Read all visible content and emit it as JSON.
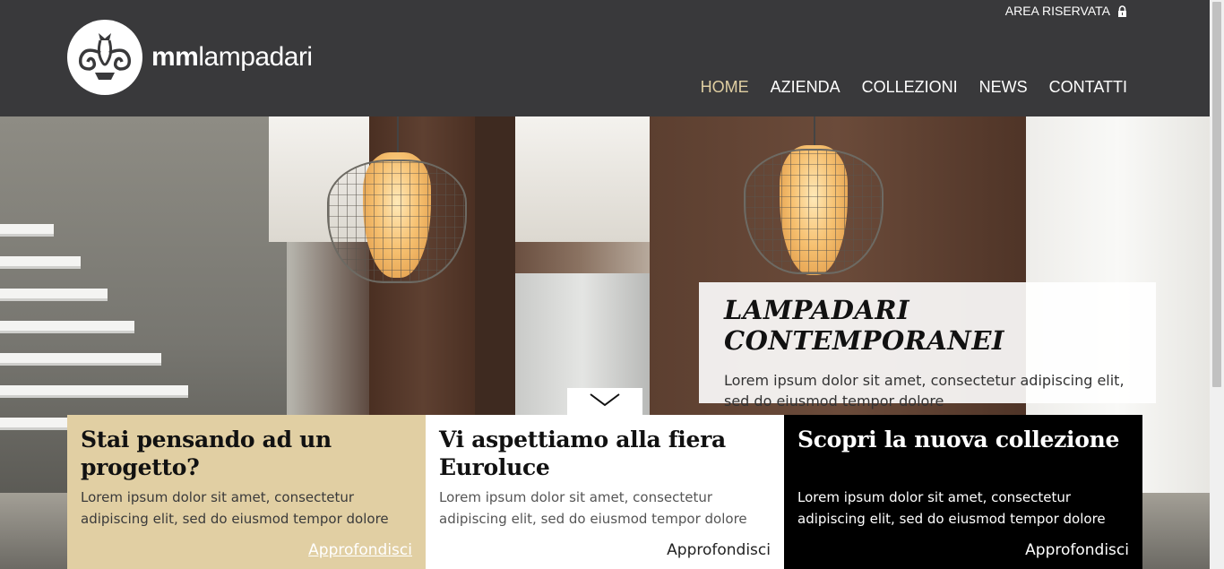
{
  "header": {
    "logo_bold": "mm",
    "logo_light": "lampadari",
    "area_riservata": "AREA RISERVATA",
    "nav": [
      {
        "label": "HOME",
        "active": true
      },
      {
        "label": "AZIENDA",
        "active": false
      },
      {
        "label": "COLLEZIONI",
        "active": false
      },
      {
        "label": "NEWS",
        "active": false
      },
      {
        "label": "CONTATTI",
        "active": false
      }
    ]
  },
  "hero": {
    "caption_title": "LAMPADARI CONTEMPORANEI",
    "caption_text": "Lorem ipsum dolor sit amet, consectetur adipiscing elit, sed do eiusmod tempor dolore"
  },
  "cards": [
    {
      "title": "Stai pensando ad un progetto?",
      "text": "Lorem ipsum dolor sit amet, consectetur adipiscing elit, sed do eiusmod tempor dolore",
      "link": "Approfondisci"
    },
    {
      "title": "Vi aspettiamo alla fiera Euroluce",
      "text": "Lorem ipsum dolor sit amet, consectetur adipiscing elit, sed do eiusmod tempor dolore",
      "link": "Approfondisci"
    },
    {
      "title": "Scopri la nuova collezione",
      "text": "Lorem ipsum dolor sit amet, consectetur adipiscing elit, sed do eiusmod tempor dolore",
      "link": "Approfondisci"
    }
  ],
  "colors": {
    "header_bg": "#39393b",
    "nav_active": "#e0cfa2",
    "card_beige": "#e1cfa3",
    "card_white": "#ffffff",
    "card_black": "#000000"
  },
  "icons": {
    "logo": "chandelier-logo-icon",
    "lock": "lock-icon",
    "scroll_down": "chevron-down-icon"
  }
}
